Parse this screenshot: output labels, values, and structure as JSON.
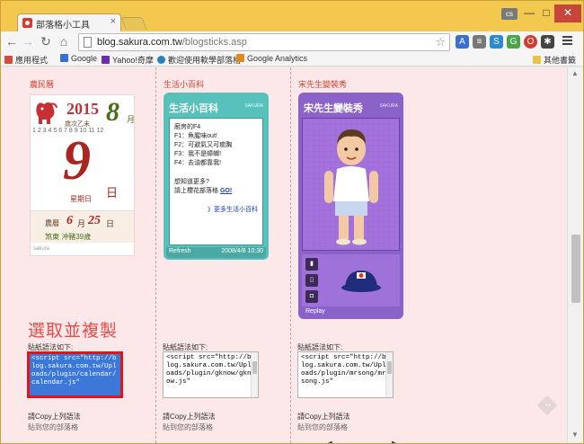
{
  "browser": {
    "tab_title": "部落格小工具",
    "tab_close": "×",
    "user_badge": "cs",
    "minimize": "—",
    "maximize": "□",
    "close": "✕",
    "url_host": "blog.sakura.com.tw",
    "url_path": "/blogsticks.asp",
    "bookmarks": [
      {
        "label": "應用程式",
        "color": "#d64a3a"
      },
      {
        "label": "Google",
        "color": "#3b6fd8"
      },
      {
        "label": "Yahoo!奇摩",
        "color": "#6a2bb5"
      },
      {
        "label": "歡迎使用軟學部落格",
        "color": "#2a7ec2"
      },
      {
        "label": "Google Analytics",
        "color": "#e28a1f"
      }
    ],
    "other_bookmarks": "其他書籤"
  },
  "columns": {
    "left_title": "農民曆",
    "mid_title": "生活小百科",
    "right_title": "宋先生變裝秀"
  },
  "calendar": {
    "year": "2015",
    "year_sub": "歲次乙未",
    "month": "8",
    "month_unit": "月",
    "days_row1": "1 2 3 4 5 6 7 8 9 10 11 12",
    "days_row2": "13 14 15 16 17 18 19 20 21 22 23 24 25 26 27 28 29 30 31",
    "day": "9",
    "day_unit": "日",
    "weekday": "星期日",
    "lunar_label": "農曆",
    "lunar_month": "6",
    "lunar_month_unit": "月",
    "lunar_day": "25",
    "lunar_day_unit": "日",
    "conflict": "煞東  沖豬39歲",
    "brand": "sakura"
  },
  "life": {
    "header": "生活小百科",
    "logo": "SAKURA",
    "lines": [
      "廚房的F4",
      "F1：魚腥味out!",
      "F2：可避氣又可癒胸",
      "F3：我不是蟑螂!",
      "F4：去油都靠我!"
    ],
    "more_q": "想知道更多?",
    "more_click": "請上櫻花部落格",
    "go": "GO!",
    "more_link": "》更多生活小百科",
    "refresh": "Refresh",
    "stamp": "2008/4/8 10:30"
  },
  "song": {
    "header": "宋先生變裝秀",
    "logo": "SAKURA",
    "replay": "Replay"
  },
  "annotation": "選取並複製",
  "code": {
    "label": "貼紙語法如下:",
    "left": "<script src=\"http://blog.sakura.com.tw/Uploads/plugin/calendar/calendar.js\"",
    "mid": "<script src=\"http://blog.sakura.com.tw/Uploads/plugin/gknow/gknow.js\"",
    "right": "<script src=\"http://blog.sakura.com.tw/Uploads/plugin/mrsong/mrsong.js\"",
    "copy_label": "請Copy上列語法",
    "copy_label2": "貼到您的部落格"
  }
}
